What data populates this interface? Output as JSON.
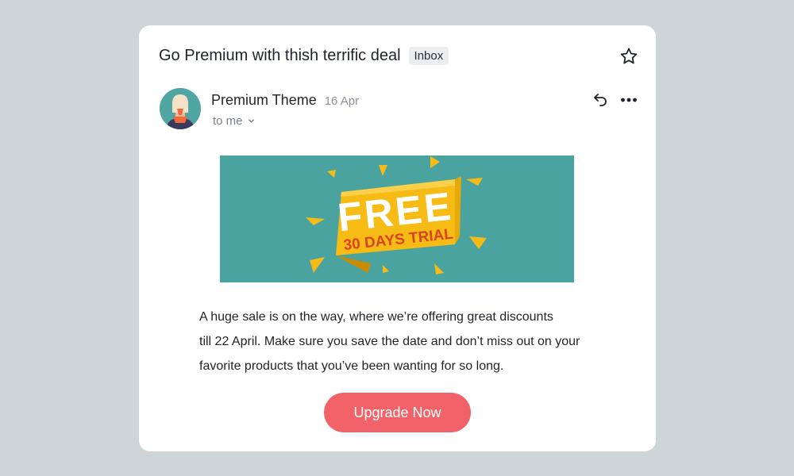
{
  "email": {
    "subject": "Go Premium with thish terrific deal",
    "label": "Inbox",
    "sender_name": "Premium Theme",
    "date": "16 Apr",
    "recipient": "to me",
    "banner": {
      "headline": "FREE",
      "subline": "30 DAYS TRIAL"
    },
    "body_lines": [
      "A huge sale is on the way, where we’re offering great discounts",
      "till 22 April. Make sure you save the date and don’t miss out on your",
      "favorite products that you’ve been wanting for so long."
    ],
    "cta_label": "Upgrade Now"
  },
  "icons": {
    "star": "star-icon",
    "reply": "reply-icon",
    "more": "more-horizontal-icon",
    "chevron": "chevron-down-icon"
  },
  "colors": {
    "page_background": "#cdd5d8",
    "card": "#ffffff",
    "banner": "#4ba39f",
    "ribbon": "#f7bb16",
    "ribbon_text": "#d9441f",
    "cta": "#f26369"
  }
}
